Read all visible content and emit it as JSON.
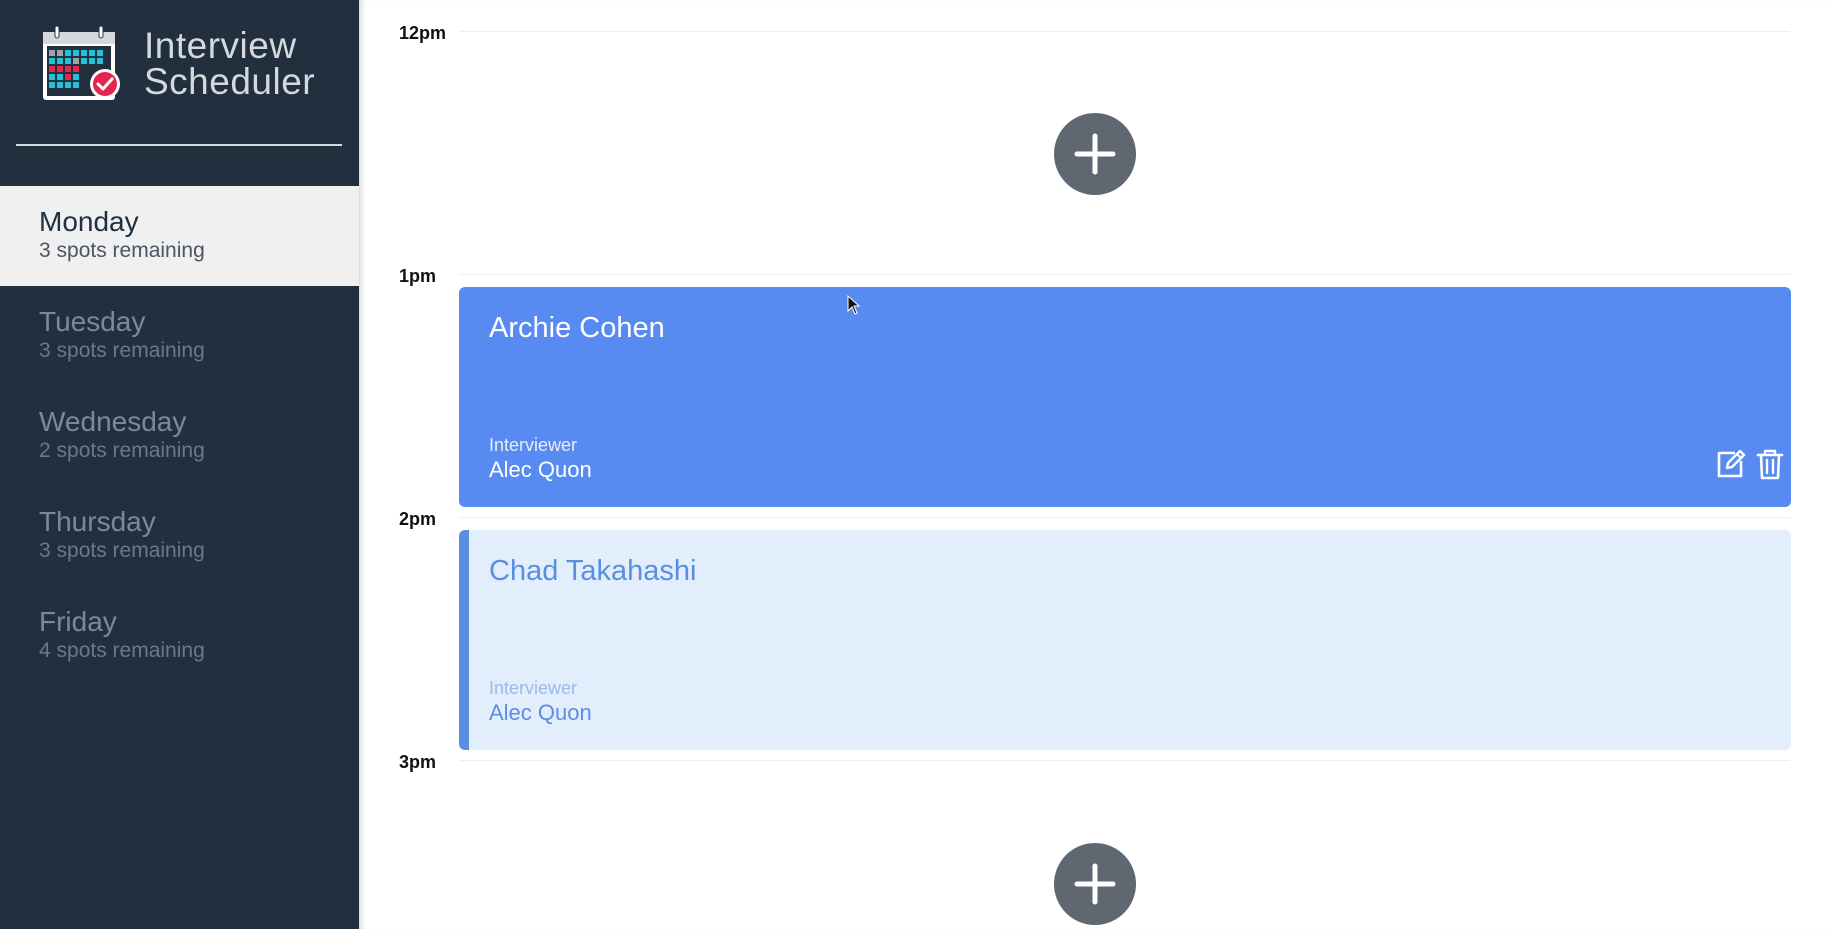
{
  "app": {
    "title_line1": "Interview",
    "title_line2": "Scheduler",
    "logo_icon": "calendar-check-icon"
  },
  "sidebar": {
    "days": [
      {
        "name": "Monday",
        "spots": "3 spots remaining",
        "selected": true
      },
      {
        "name": "Tuesday",
        "spots": "3 spots remaining",
        "selected": false
      },
      {
        "name": "Wednesday",
        "spots": "2 spots remaining",
        "selected": false
      },
      {
        "name": "Thursday",
        "spots": "3 spots remaining",
        "selected": false
      },
      {
        "name": "Friday",
        "spots": "4 spots remaining",
        "selected": false
      }
    ]
  },
  "schedule": {
    "times": [
      "12pm",
      "1pm",
      "2pm",
      "3pm"
    ],
    "appointments": [
      {
        "student": "Archie Cohen",
        "interviewer_label": "Interviewer",
        "interviewer": "Alec Quon",
        "state": "active"
      },
      {
        "student": "Chad Takahashi",
        "interviewer_label": "Interviewer",
        "interviewer": "Alec Quon",
        "state": "booked"
      }
    ],
    "add_icon": "plus-icon",
    "edit_icon": "edit-icon",
    "delete_icon": "trash-icon"
  },
  "colors": {
    "sidebar_bg": "#222f3e",
    "selected_day_bg": "#f0f0f0",
    "appointment_active": "#578bf2",
    "appointment_booked": "#e3eefc",
    "add_button": "#5f6870"
  }
}
